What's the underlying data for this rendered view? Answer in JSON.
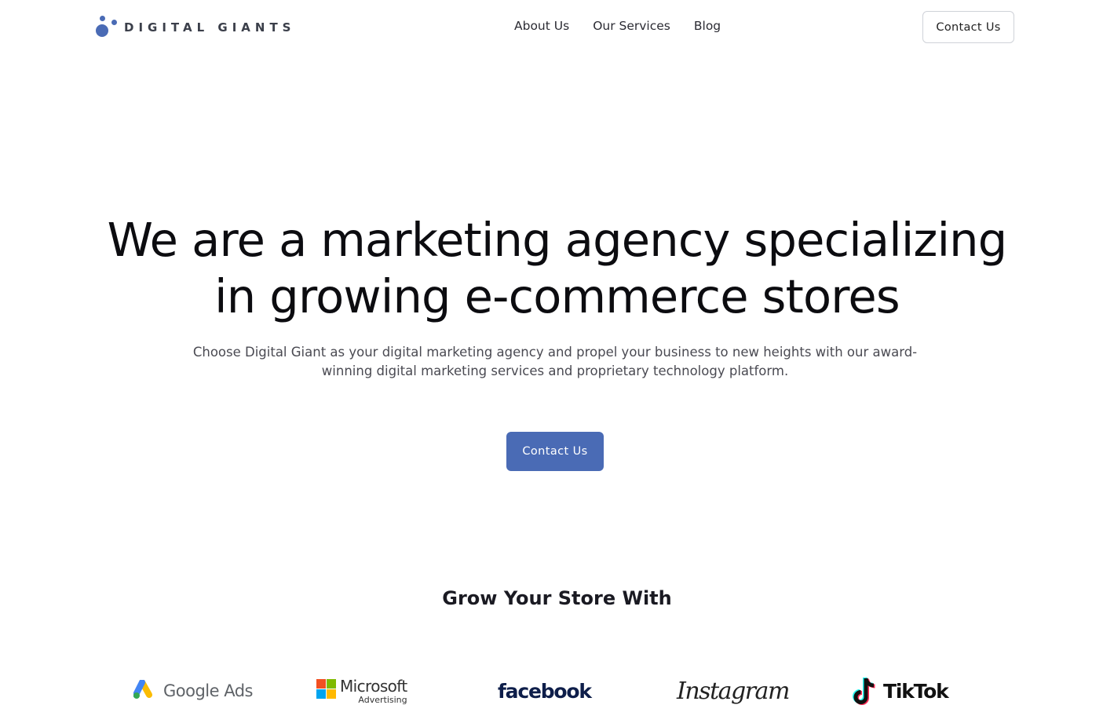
{
  "brand": {
    "name": "DIGITAL GIANTS",
    "accent_color": "#4a6bb5"
  },
  "nav": {
    "items": [
      {
        "label": "About Us"
      },
      {
        "label": "Our Services"
      },
      {
        "label": "Blog"
      }
    ],
    "cta_label": "Contact Us"
  },
  "hero": {
    "title_line1": "We are a marketing agency specializing",
    "title_line2": "in growing e-commerce stores",
    "subtitle_line1": "Choose Digital Giant as your digital marketing agency and propel your business to new heights with our award-",
    "subtitle_line2": "winning digital marketing services and proprietary technology platform.",
    "cta_label": "Contact Us"
  },
  "partners": {
    "title": "Grow Your Store With",
    "google": {
      "label": "Google Ads",
      "icon": "google-ads-icon"
    },
    "microsoft": {
      "label": "Microsoft",
      "sublabel": "Advertising",
      "icon": "microsoft-icon"
    },
    "facebook": {
      "label": "facebook"
    },
    "instagram": {
      "label": "Instagram"
    },
    "tiktok": {
      "label": "TikTok",
      "icon": "tiktok-icon"
    }
  }
}
